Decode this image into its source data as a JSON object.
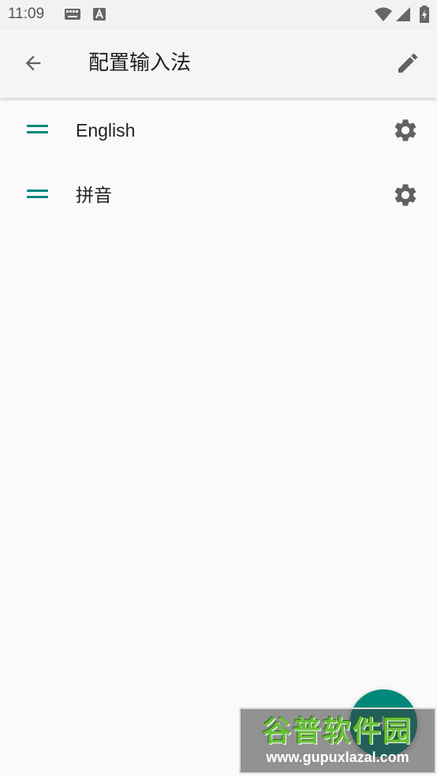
{
  "status_bar": {
    "time": "11:09"
  },
  "app_bar": {
    "title": "配置输入法"
  },
  "list": {
    "items": [
      {
        "label": "English"
      },
      {
        "label": "拼音"
      }
    ]
  },
  "watermark": {
    "name": "谷普软件园",
    "url": "www.gupuxlazal.com"
  },
  "colors": {
    "accent": "#00897b",
    "icon": "#616161",
    "background": "#fafafa"
  },
  "icons": [
    "keyboard-icon",
    "a-icon",
    "wifi-icon",
    "signal-icon",
    "battery-icon",
    "back-arrow-icon",
    "edit-pencil-icon",
    "drag-handle-icon",
    "gear-icon",
    "add-icon"
  ]
}
